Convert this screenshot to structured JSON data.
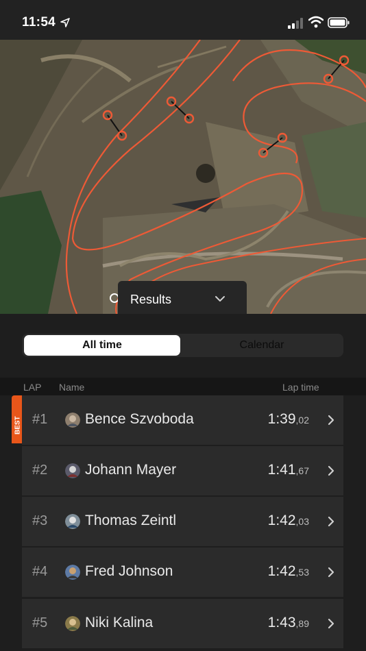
{
  "status_bar": {
    "time": "11:54"
  },
  "results_dropdown": {
    "label": "Results"
  },
  "tabs": {
    "all_time": "All time",
    "calendar": "Calendar"
  },
  "table": {
    "headers": {
      "lap": "LAP",
      "name": "Name",
      "lap_time": "Lap time"
    },
    "best_badge": "BEST",
    "rows": [
      {
        "rank": "#1",
        "name": "Bence Szvoboda",
        "time_main": "1:39",
        "time_ms": ",02"
      },
      {
        "rank": "#2",
        "name": "Johann Mayer",
        "time_main": "1:41",
        "time_ms": ",67"
      },
      {
        "rank": "#3",
        "name": "Thomas Zeintl",
        "time_main": "1:42",
        "time_ms": ",03"
      },
      {
        "rank": "#4",
        "name": "Fred Johnson",
        "time_main": "1:42",
        "time_ms": ",53"
      },
      {
        "rank": "#5",
        "name": "Niki Kalina",
        "time_main": "1:43",
        "time_ms": ",89"
      }
    ]
  },
  "colors": {
    "accent": "#e8561a",
    "track": "#ee5a36",
    "row_bg": "#2b2b2b"
  }
}
